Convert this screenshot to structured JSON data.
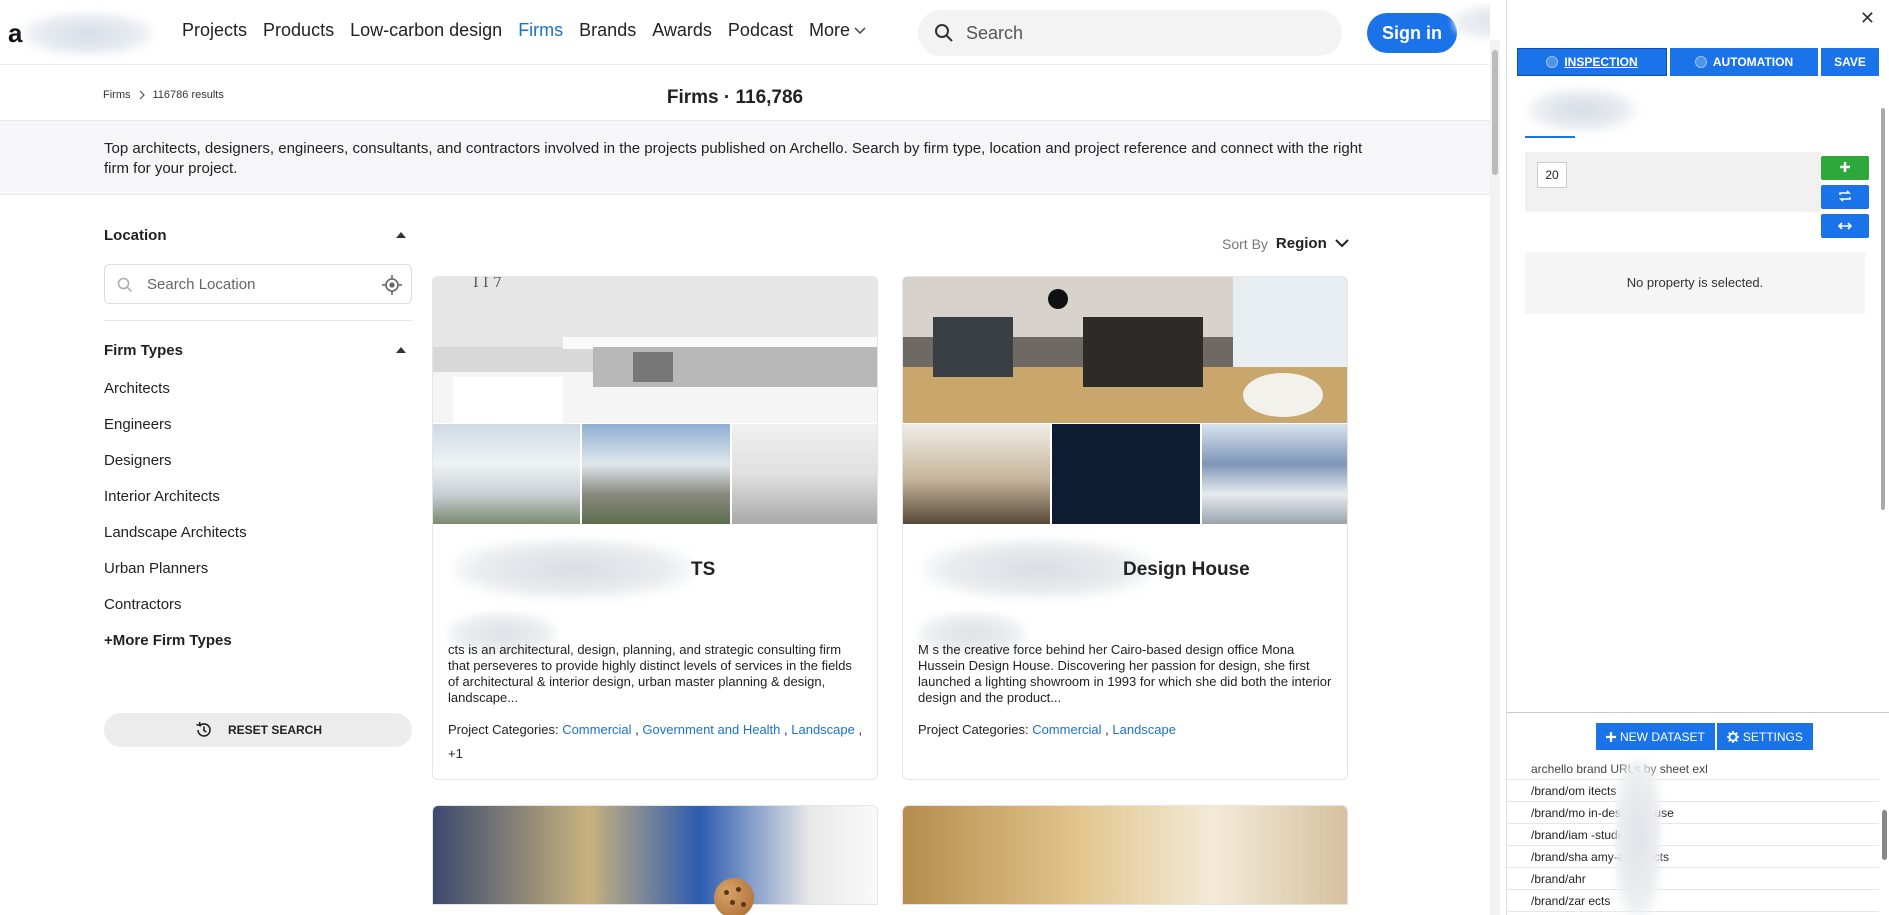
{
  "nav": {
    "logo_letter": "a",
    "links": [
      "Projects",
      "Products",
      "Low-carbon design",
      "Firms",
      "Brands",
      "Awards",
      "Podcast"
    ],
    "more": "More",
    "search_placeholder": "Search",
    "sign_in": "Sign in"
  },
  "breadcrumb": {
    "root": "Firms",
    "current": "116786 results"
  },
  "page": {
    "title": "Firms · 116,786",
    "intro": "Top architects, designers, engineers, consultants, and contractors involved in the projects published on Archello. Search by firm type, location and project reference and connect with the right firm for your project."
  },
  "filters": {
    "location_label": "Location",
    "location_placeholder": "Search Location",
    "firm_types_label": "Firm Types",
    "firm_types": [
      "Architects",
      "Engineers",
      "Designers",
      "Interior Architects",
      "Landscape Architects",
      "Urban Planners",
      "Contractors"
    ],
    "more_types": "+More Firm Types",
    "reset": "RESET SEARCH"
  },
  "sort": {
    "label": "Sort By",
    "value": "Region"
  },
  "cards": [
    {
      "name": "TS",
      "description": "cts is an architectural, design, planning, and strategic consulting firm that perseveres to provide highly distinct levels of services in the fields of architectural & interior design, urban master planning & design, landscape...",
      "categories_label": "Project Categories:",
      "categories": [
        "Commercial",
        "Government and Health",
        "Landscape"
      ],
      "extra": "+1"
    },
    {
      "name": "Design House",
      "description": "M                  s the creative force behind her Cairo-based design office Mona Hussein Design House. Discovering her passion for design, she first launched a lighting showroom in 1993 for which she did both the interior design and the product...",
      "categories_label": "Project Categories:",
      "categories": [
        "Commercial",
        "Landscape"
      ],
      "extra": ""
    }
  ],
  "panel": {
    "close": "✕",
    "tab_inspection": "INSPECTION",
    "tab_automation": "AUTOMATION",
    "save": "SAVE",
    "count_value": "20",
    "no_property": "No property is selected.",
    "new_dataset": "NEW DATASET",
    "settings": "SETTINGS",
    "dataset_header": "archello brand      URLs by sheet exl",
    "dataset_rows": [
      "/brand/om          itects",
      "/brand/mo          in-design-house",
      "/brand/iam          -studio",
      "/brand/sha          amy-architects",
      "/brand/ahr",
      "/brand/zar          ects"
    ]
  },
  "colors": {
    "accent": "#1a73e8",
    "link": "#1a73c8",
    "green": "#2ea83a"
  }
}
